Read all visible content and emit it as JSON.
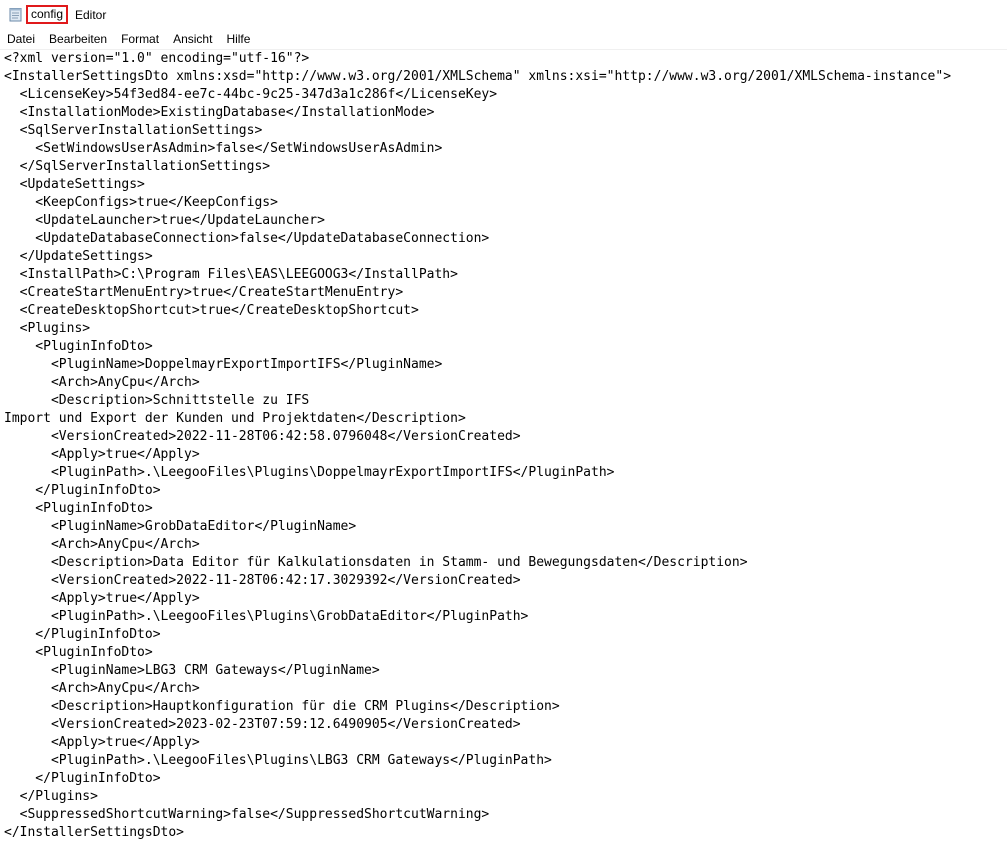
{
  "window": {
    "file_name": "config",
    "app_name": "Editor",
    "icon": "notepad-icon"
  },
  "menu": [
    "Datei",
    "Bearbeiten",
    "Format",
    "Ansicht",
    "Hilfe"
  ],
  "editor": {
    "lines": [
      "<?xml version=\"1.0\" encoding=\"utf-16\"?>",
      "<InstallerSettingsDto xmlns:xsd=\"http://www.w3.org/2001/XMLSchema\" xmlns:xsi=\"http://www.w3.org/2001/XMLSchema-instance\">",
      "  <LicenseKey>54f3ed84-ee7c-44bc-9c25-347d3a1c286f</LicenseKey>",
      "  <InstallationMode>ExistingDatabase</InstallationMode>",
      "  <SqlServerInstallationSettings>",
      "    <SetWindowsUserAsAdmin>false</SetWindowsUserAsAdmin>",
      "  </SqlServerInstallationSettings>",
      "  <UpdateSettings>",
      "    <KeepConfigs>true</KeepConfigs>",
      "    <UpdateLauncher>true</UpdateLauncher>",
      "    <UpdateDatabaseConnection>false</UpdateDatabaseConnection>",
      "  </UpdateSettings>",
      "  <InstallPath>C:\\Program Files\\EAS\\LEEGOOG3</InstallPath>",
      "  <CreateStartMenuEntry>true</CreateStartMenuEntry>",
      "  <CreateDesktopShortcut>true</CreateDesktopShortcut>",
      "  <Plugins>",
      "    <PluginInfoDto>",
      "      <PluginName>DoppelmayrExportImportIFS</PluginName>",
      "      <Arch>AnyCpu</Arch>",
      "      <Description>Schnittstelle zu IFS",
      "Import und Export der Kunden und Projektdaten</Description>",
      "      <VersionCreated>2022-11-28T06:42:58.0796048</VersionCreated>",
      "      <Apply>true</Apply>",
      "      <PluginPath>.\\LeegooFiles\\Plugins\\DoppelmayrExportImportIFS</PluginPath>",
      "    </PluginInfoDto>",
      "    <PluginInfoDto>",
      "      <PluginName>GrobDataEditor</PluginName>",
      "      <Arch>AnyCpu</Arch>",
      "      <Description>Data Editor für Kalkulationsdaten in Stamm- und Bewegungsdaten</Description>",
      "      <VersionCreated>2022-11-28T06:42:17.3029392</VersionCreated>",
      "      <Apply>true</Apply>",
      "      <PluginPath>.\\LeegooFiles\\Plugins\\GrobDataEditor</PluginPath>",
      "    </PluginInfoDto>",
      "    <PluginInfoDto>",
      "      <PluginName>LBG3 CRM Gateways</PluginName>",
      "      <Arch>AnyCpu</Arch>",
      "      <Description>Hauptkonfiguration für die CRM Plugins</Description>",
      "      <VersionCreated>2023-02-23T07:59:12.6490905</VersionCreated>",
      "      <Apply>true</Apply>",
      "      <PluginPath>.\\LeegooFiles\\Plugins\\LBG3 CRM Gateways</PluginPath>",
      "    </PluginInfoDto>",
      "  </Plugins>",
      "  <SuppressedShortcutWarning>false</SuppressedShortcutWarning>",
      "</InstallerSettingsDto>"
    ]
  }
}
